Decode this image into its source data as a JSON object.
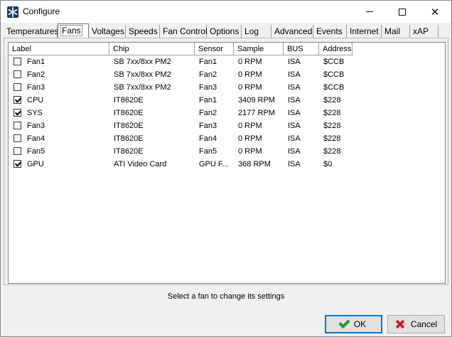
{
  "window": {
    "title": "Configure",
    "icon": "fan-icon"
  },
  "tabs": [
    {
      "label": "Temperatures",
      "active": false
    },
    {
      "label": "Fans",
      "active": true
    },
    {
      "label": "Voltages",
      "active": false
    },
    {
      "label": "Speeds",
      "active": false
    },
    {
      "label": "Fan Control",
      "active": false
    },
    {
      "label": "Options",
      "active": false
    },
    {
      "label": "Log",
      "active": false
    },
    {
      "label": "Advanced",
      "active": false
    },
    {
      "label": "Events",
      "active": false
    },
    {
      "label": "Internet",
      "active": false
    },
    {
      "label": "Mail",
      "active": false
    },
    {
      "label": "xAP",
      "active": false
    }
  ],
  "list": {
    "columns": [
      "Label",
      "Chip",
      "Sensor",
      "Sample",
      "BUS",
      "Address"
    ],
    "rows": [
      {
        "checked": false,
        "label": "Fan1",
        "chip": "SB 7xx/8xx PM2",
        "sensor": "Fan1",
        "sample": "0 RPM",
        "bus": "ISA",
        "address": "$CCB"
      },
      {
        "checked": false,
        "label": "Fan2",
        "chip": "SB 7xx/8xx PM2",
        "sensor": "Fan2",
        "sample": "0 RPM",
        "bus": "ISA",
        "address": "$CCB"
      },
      {
        "checked": false,
        "label": "Fan3",
        "chip": "SB 7xx/8xx PM2",
        "sensor": "Fan3",
        "sample": "0 RPM",
        "bus": "ISA",
        "address": "$CCB"
      },
      {
        "checked": true,
        "label": "CPU",
        "chip": "IT8620E",
        "sensor": "Fan1",
        "sample": "3409 RPM",
        "bus": "ISA",
        "address": "$228"
      },
      {
        "checked": true,
        "label": "SYS",
        "chip": "IT8620E",
        "sensor": "Fan2",
        "sample": "2177 RPM",
        "bus": "ISA",
        "address": "$228"
      },
      {
        "checked": false,
        "label": "Fan3",
        "chip": "IT8620E",
        "sensor": "Fan3",
        "sample": "0 RPM",
        "bus": "ISA",
        "address": "$228"
      },
      {
        "checked": false,
        "label": "Fan4",
        "chip": "IT8620E",
        "sensor": "Fan4",
        "sample": "0 RPM",
        "bus": "ISA",
        "address": "$228"
      },
      {
        "checked": false,
        "label": "Fan5",
        "chip": "IT8620E",
        "sensor": "Fan5",
        "sample": "0 RPM",
        "bus": "ISA",
        "address": "$228"
      },
      {
        "checked": true,
        "label": "GPU",
        "chip": "ATI Video Card",
        "sensor": "GPU F...",
        "sample": "368 RPM",
        "bus": "ISA",
        "address": "$0"
      }
    ]
  },
  "status": "Select a fan to change its settings",
  "buttons": {
    "ok": "OK",
    "cancel": "Cancel"
  }
}
